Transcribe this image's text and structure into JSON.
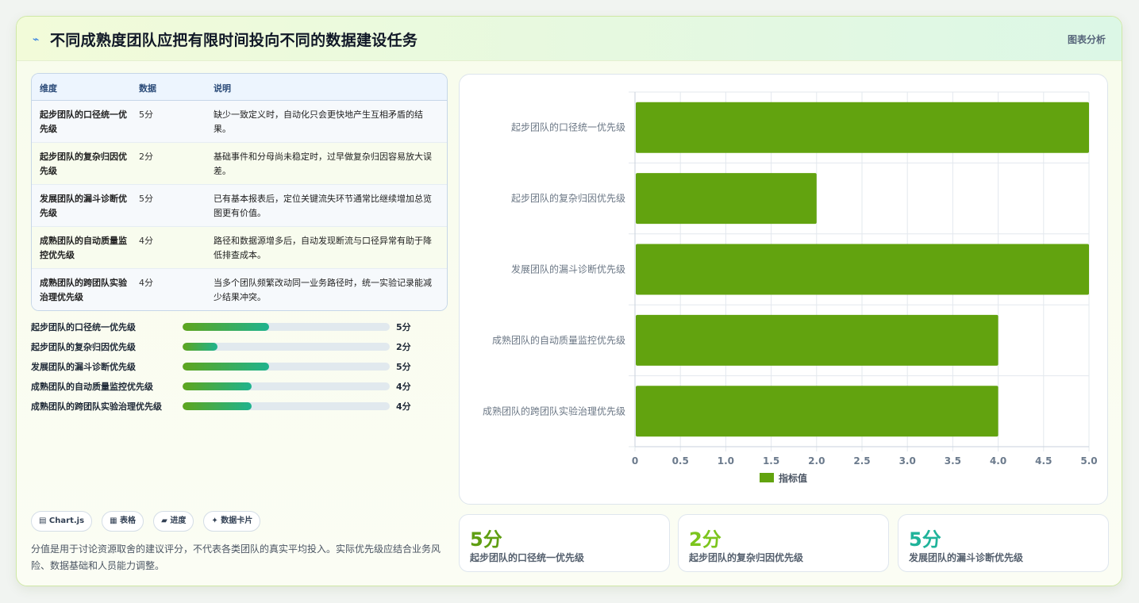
{
  "header": {
    "title": "不同成熟度团队应把有限时间投向不同的数据建设任务",
    "tag": "图表分析"
  },
  "table": {
    "columns": [
      "维度",
      "数据",
      "说明"
    ],
    "rows": [
      {
        "dim": "起步团队的口径统一优先级",
        "val": "5分",
        "desc": "缺少一致定义时，自动化只会更快地产生互相矛盾的结果。"
      },
      {
        "dim": "起步团队的复杂归因优先级",
        "val": "2分",
        "desc": "基础事件和分母尚未稳定时，过早做复杂归因容易放大误差。"
      },
      {
        "dim": "发展团队的漏斗诊断优先级",
        "val": "5分",
        "desc": "已有基本报表后，定位关键流失环节通常比继续增加总览图更有价值。"
      },
      {
        "dim": "成熟团队的自动质量监控优先级",
        "val": "4分",
        "desc": "路径和数据源增多后，自动发现断流与口径异常有助于降低排查成本。"
      },
      {
        "dim": "成熟团队的跨团队实验治理优先级",
        "val": "4分",
        "desc": "当多个团队频繁改动同一业务路径时，统一实验记录能减少结果冲突。"
      }
    ]
  },
  "progress": [
    {
      "label": "起步团队的口径统一优先级",
      "value": 5,
      "value_label": "5分"
    },
    {
      "label": "起步团队的复杂归因优先级",
      "value": 2,
      "value_label": "2分"
    },
    {
      "label": "发展团队的漏斗诊断优先级",
      "value": 5,
      "value_label": "5分"
    },
    {
      "label": "成熟团队的自动质量监控优先级",
      "value": 4,
      "value_label": "4分"
    },
    {
      "label": "成熟团队的跨团队实验治理优先级",
      "value": 4,
      "value_label": "4分"
    }
  ],
  "progress_max": 12,
  "chips": [
    "▤ Chart.js",
    "▦ 表格",
    "▰ 进度",
    "✦ 数据卡片"
  ],
  "note": "分值是用于讨论资源取舍的建议评分，不代表各类团队的真实平均投入。实际优先级应结合业务风险、数据基础和人员能力调整。",
  "chart_data": {
    "type": "bar",
    "orientation": "horizontal",
    "categories": [
      "起步团队的口径统一优先级",
      "起步团队的复杂归因优先级",
      "发展团队的漏斗诊断优先级",
      "成熟团队的自动质量监控优先级",
      "成熟团队的跨团队实验治理优先级"
    ],
    "series": [
      {
        "name": "指标值",
        "values": [
          5,
          2,
          5,
          4,
          4
        ],
        "color": "#62a30f"
      }
    ],
    "xlim": [
      0,
      5
    ],
    "xticks": [
      "0",
      "0.5",
      "1.0",
      "1.5",
      "2.0",
      "2.5",
      "3.0",
      "3.5",
      "4.0",
      "4.5",
      "5.0"
    ],
    "grid": true,
    "legend": "bottom"
  },
  "stats": [
    {
      "value": "5分",
      "label": "起步团队的口径统一优先级",
      "color": "#5f9e12"
    },
    {
      "value": "2分",
      "label": "起步团队的复杂归因优先级",
      "color": "#7cc51d"
    },
    {
      "value": "5分",
      "label": "发展团队的漏斗诊断优先级",
      "color": "#1fb39a"
    }
  ]
}
